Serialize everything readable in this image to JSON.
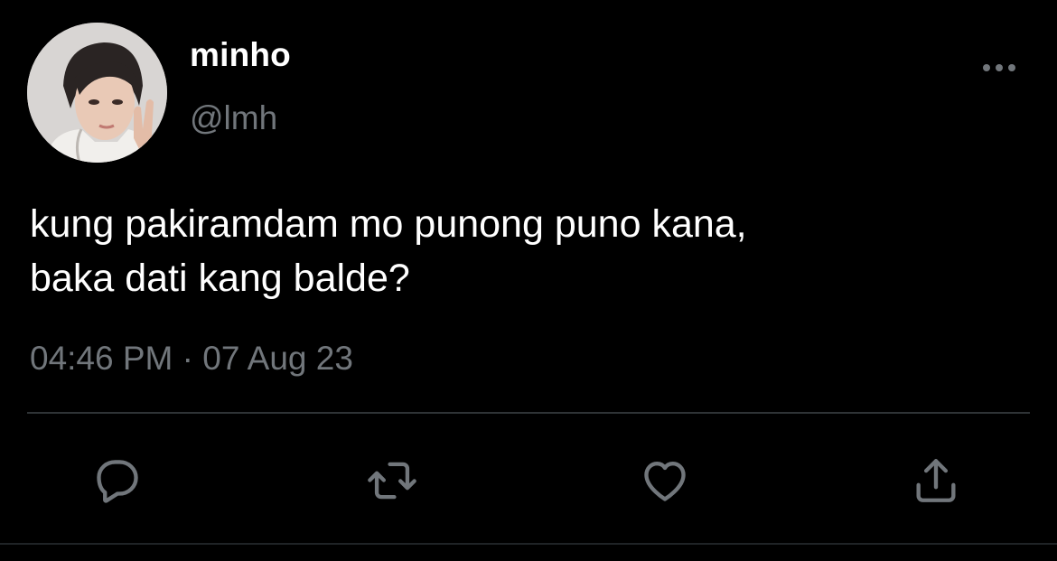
{
  "tweet": {
    "display_name": "minho",
    "handle": "@lmh",
    "text_lines": [
      "kung pakiramdam mo punong puno kana,",
      "baka dati kang balde?"
    ],
    "timestamp": "04:46 PM · 07 Aug 23"
  },
  "actions": {
    "reply_icon": "reply-icon",
    "retweet_icon": "retweet-icon",
    "like_icon": "heart-icon",
    "share_icon": "share-icon",
    "more_icon": "more-icon"
  },
  "colors": {
    "background": "#000000",
    "text_primary": "#ffffff",
    "text_secondary": "#71767b",
    "divider": "#2f3336"
  }
}
